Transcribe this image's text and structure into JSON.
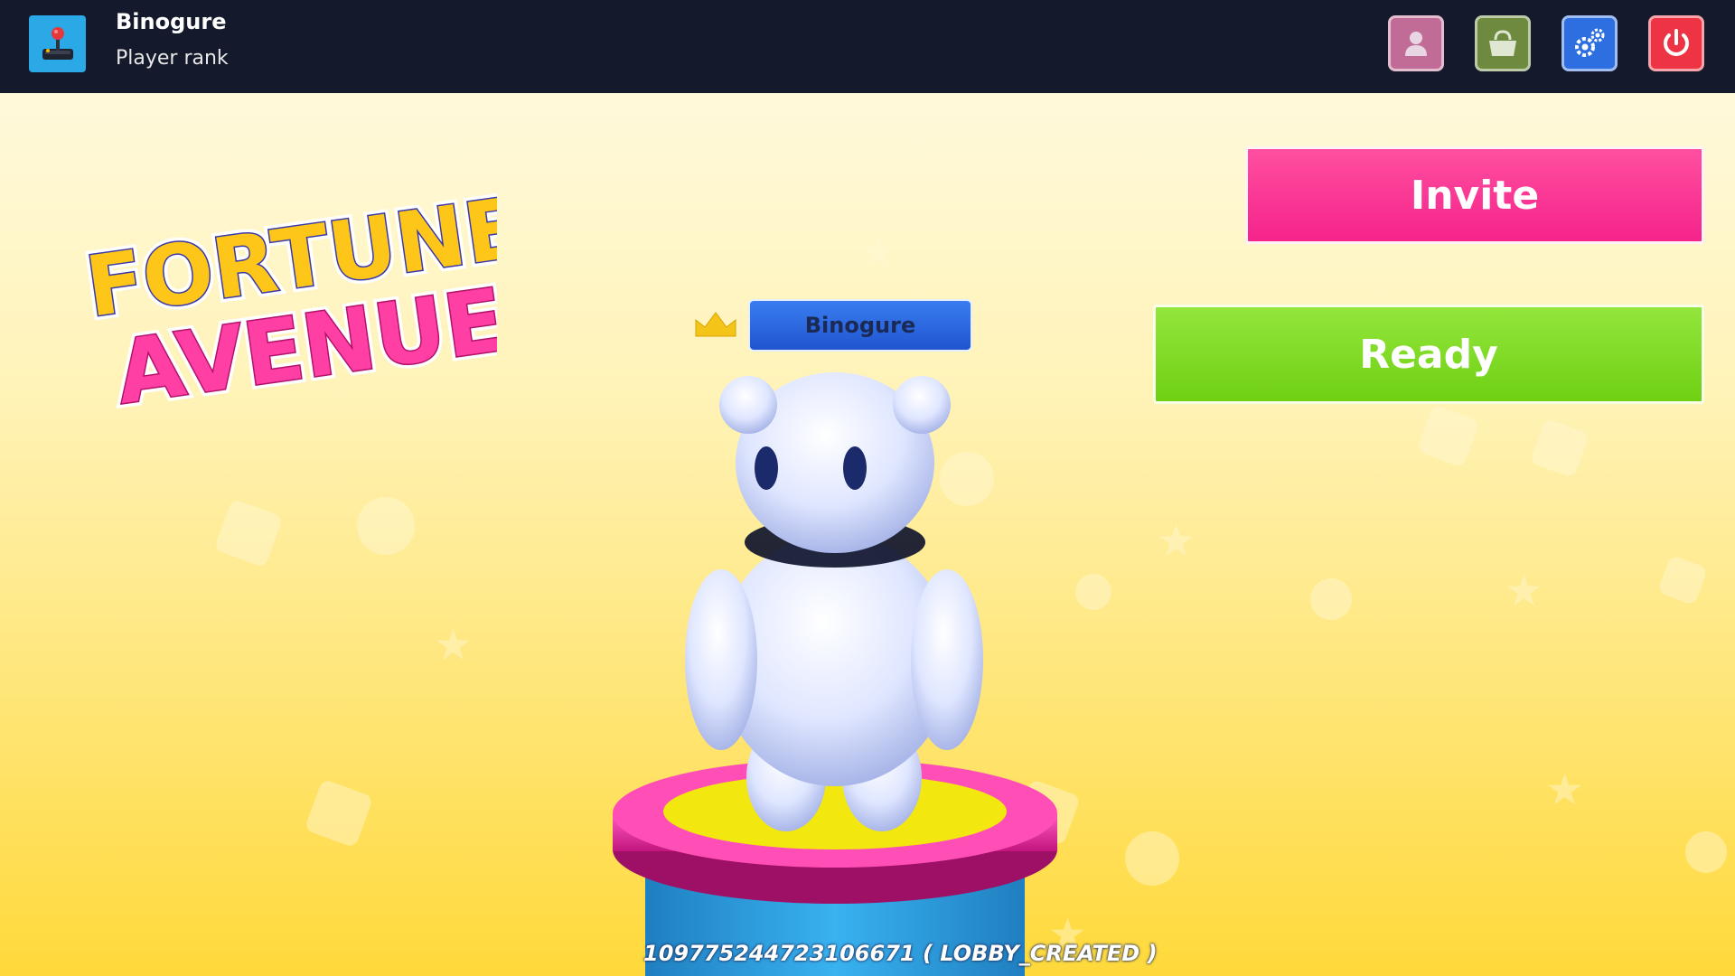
{
  "topbar": {
    "player_name": "Binogure",
    "player_rank": "Player rank",
    "avatar_icon": "joystick-icon",
    "buttons": [
      {
        "icon": "profile-icon",
        "color": "#c06c96"
      },
      {
        "icon": "shop-bag-icon",
        "color": "#6e8a3e"
      },
      {
        "icon": "settings-gears-icon",
        "color": "#2d6fe0"
      },
      {
        "icon": "power-icon",
        "color": "#ee3344"
      }
    ]
  },
  "logo": {
    "line1": "FORTUNE",
    "line2": "AVENUE"
  },
  "lobby": {
    "host_name": "Binogure",
    "lobby_status": "109775244723106671 ( LOBBY_CREATED )"
  },
  "actions": {
    "invite_label": "Invite",
    "ready_label": "Ready"
  },
  "colors": {
    "topbar": "#141a2b",
    "invite": "#f5238a",
    "ready": "#6fd013",
    "name_tag": "#1f55d0",
    "pedestal_top": "#e83aa8",
    "pedestal_base": "#2ba8e6"
  }
}
